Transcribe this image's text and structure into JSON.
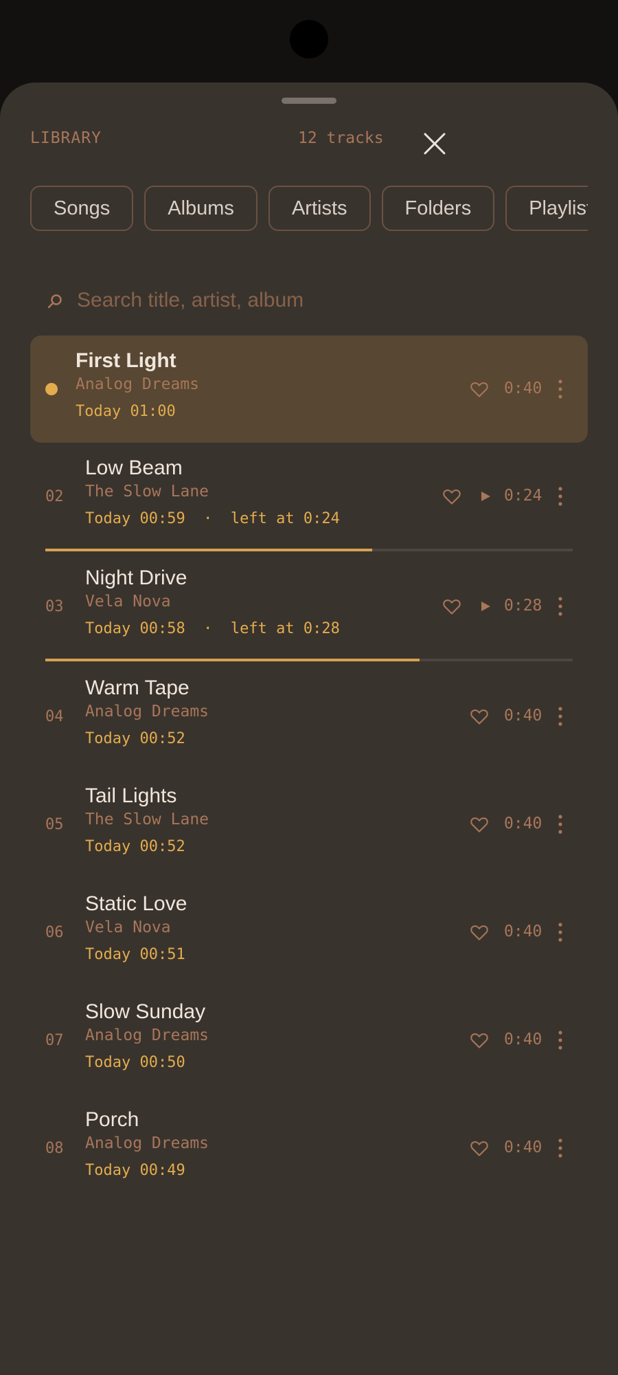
{
  "header": {
    "title": "LIBRARY",
    "track_count": "12 tracks",
    "close_icon": "close-icon"
  },
  "tabs": [
    "Songs",
    "Albums",
    "Artists",
    "Folders",
    "Playlists"
  ],
  "search": {
    "placeholder": "Search title, artist, album",
    "value": "",
    "icon": "search-icon"
  },
  "tracks": [
    {
      "num": "",
      "title": "First Light",
      "artist": "Analog Dreams",
      "meta": "Today 01:00",
      "duration": "0:40",
      "now_playing": true,
      "partial": false
    },
    {
      "num": "02",
      "title": "Low Beam",
      "artist": "The Slow Lane",
      "meta": "Today 00:59  ·  left at 0:24",
      "duration": "0:24",
      "now_playing": false,
      "partial": true,
      "progress": 0.62
    },
    {
      "num": "03",
      "title": "Night Drive",
      "artist": "Vela Nova",
      "meta": "Today 00:58  ·  left at 0:28",
      "duration": "0:28",
      "now_playing": false,
      "partial": true,
      "progress": 0.71
    },
    {
      "num": "04",
      "title": "Warm Tape",
      "artist": "Analog Dreams",
      "meta": "Today 00:52",
      "duration": "0:40",
      "now_playing": false,
      "partial": false
    },
    {
      "num": "05",
      "title": "Tail Lights",
      "artist": "The Slow Lane",
      "meta": "Today 00:52",
      "duration": "0:40",
      "now_playing": false,
      "partial": false
    },
    {
      "num": "06",
      "title": "Static Love",
      "artist": "Vela Nova",
      "meta": "Today 00:51",
      "duration": "0:40",
      "now_playing": false,
      "partial": false
    },
    {
      "num": "07",
      "title": "Slow Sunday",
      "artist": "Analog Dreams",
      "meta": "Today 00:50",
      "duration": "0:40",
      "now_playing": false,
      "partial": false
    },
    {
      "num": "08",
      "title": "Porch",
      "artist": "Analog Dreams",
      "meta": "Today 00:49",
      "duration": "0:40",
      "now_playing": false,
      "partial": false
    }
  ],
  "colors": {
    "background": "#39332d",
    "accent": "#e3ac4d",
    "muted": "#a8765a",
    "active_row": "#574733"
  }
}
